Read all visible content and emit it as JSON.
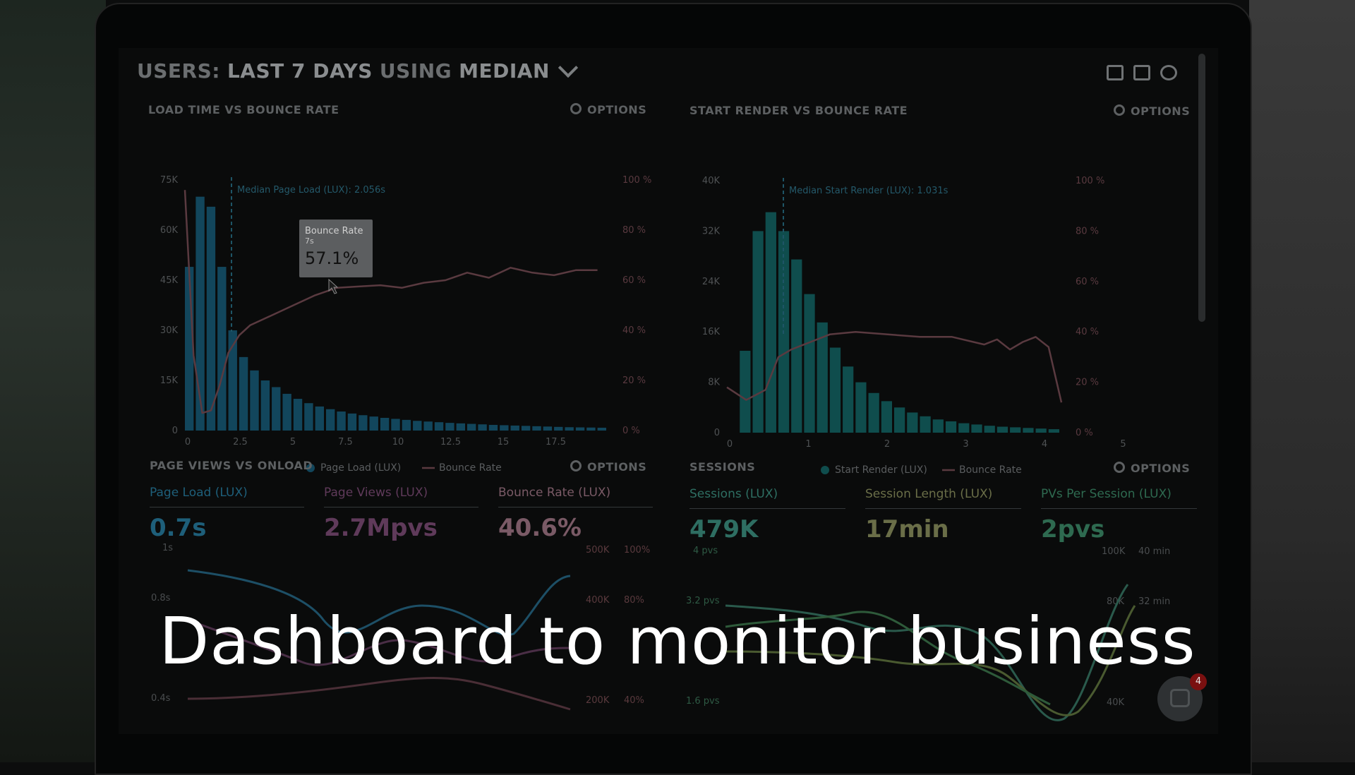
{
  "header": {
    "users_label": "USERS:",
    "period_label": "LAST 7 DAYS",
    "using_label": "USING",
    "stat_label": "MEDIAN"
  },
  "panels": {
    "load_time": {
      "title": "LOAD TIME VS BOUNCE RATE",
      "options": "OPTIONS",
      "median_note": "Median Page Load (LUX): 2.056s",
      "tooltip": {
        "title": "Bounce Rate",
        "sub": "7s",
        "value": "57.1%"
      },
      "legend": [
        "Page Load (LUX)",
        "Bounce Rate"
      ]
    },
    "start_render": {
      "title": "START RENDER VS BOUNCE RATE",
      "options": "OPTIONS",
      "median_note": "Median Start Render (LUX): 1.031s",
      "legend": [
        "Start Render (LUX)",
        "Bounce Rate"
      ]
    },
    "page_views": {
      "title": "PAGE VIEWS VS ONLOAD",
      "options": "OPTIONS",
      "metrics": [
        {
          "label": "Page Load (LUX)",
          "value": "0.7s",
          "color": "#1e5f7a"
        },
        {
          "label": "Page Views (LUX)",
          "value": "2.7Mpvs",
          "color": "#5f3a5a"
        },
        {
          "label": "Bounce Rate (LUX)",
          "value": "40.6%",
          "color": "#7a5a66"
        }
      ]
    },
    "sessions": {
      "title": "SESSIONS",
      "options": "OPTIONS",
      "metrics": [
        {
          "label": "Sessions (LUX)",
          "value": "479K",
          "color": "#2e6e62"
        },
        {
          "label": "Session Length (LUX)",
          "value": "17min",
          "color": "#6a6e48"
        },
        {
          "label": "PVs Per Session (LUX)",
          "value": "2pvs",
          "color": "#2e6a50"
        }
      ]
    }
  },
  "overlay_title": "Dashboard to monitor business",
  "chat_badge": "4",
  "chart_data": [
    {
      "type": "bar",
      "title": "LOAD TIME VS BOUNCE RATE",
      "x_ticks": [
        "0",
        "2.5",
        "5",
        "7.5",
        "10",
        "12.5",
        "15",
        "17.5"
      ],
      "y_left_ticks": [
        "0",
        "15K",
        "30K",
        "45K",
        "60K",
        "75K"
      ],
      "y_right_ticks": [
        "0 %",
        "20 %",
        "40 %",
        "60 %",
        "80 %",
        "100 %"
      ],
      "xlim": [
        0,
        19.5
      ],
      "ylim": [
        0,
        75000
      ],
      "bar_width": 0.5,
      "series": [
        {
          "name": "Page Load (LUX)",
          "x": [
            0,
            0.5,
            1,
            1.5,
            2,
            2.5,
            3,
            3.5,
            4,
            4.5,
            5,
            5.5,
            6,
            6.5,
            7,
            7.5,
            8,
            8.5,
            9,
            9.5,
            10,
            10.5,
            11,
            11.5,
            12,
            12.5,
            13,
            13.5,
            14,
            14.5,
            15,
            15.5,
            16,
            16.5,
            17,
            17.5,
            18,
            18.5,
            19
          ],
          "values": [
            49000,
            70000,
            67000,
            49000,
            30000,
            22000,
            18000,
            15000,
            13000,
            11000,
            9500,
            8200,
            7200,
            6400,
            5700,
            5100,
            4600,
            4200,
            3800,
            3500,
            3200,
            2900,
            2700,
            2500,
            2300,
            2150,
            2000,
            1850,
            1700,
            1600,
            1500,
            1400,
            1300,
            1200,
            1100,
            1000,
            950,
            900,
            850
          ]
        },
        {
          "name": "Bounce Rate",
          "axis": "right",
          "x": [
            0,
            0.4,
            0.8,
            1.2,
            1.6,
            2,
            2.5,
            3,
            4,
            5,
            6,
            7,
            8,
            9,
            10,
            11,
            12,
            13,
            14,
            15,
            16,
            17,
            18,
            19
          ],
          "values": [
            96,
            30,
            7,
            8,
            18,
            31,
            38,
            42,
            46,
            50,
            54,
            57,
            57.5,
            58,
            57,
            59,
            60,
            63,
            61,
            65,
            63,
            62,
            64,
            64
          ]
        }
      ]
    },
    {
      "type": "bar",
      "title": "START RENDER VS BOUNCE RATE",
      "x_ticks": [
        "0",
        "1",
        "2",
        "3",
        "4",
        "5"
      ],
      "y_left_ticks": [
        "0",
        "8K",
        "16K",
        "24K",
        "32K",
        "40K"
      ],
      "y_right_ticks": [
        "0 %",
        "20 %",
        "40 %",
        "60 %",
        "80 %",
        "100 %"
      ],
      "xlim": [
        0,
        5.2
      ],
      "ylim": [
        0,
        40000
      ],
      "bar_width": 0.2,
      "series": [
        {
          "name": "Start Render (LUX)",
          "x": [
            0.2,
            0.4,
            0.6,
            0.8,
            1.0,
            1.2,
            1.4,
            1.6,
            1.8,
            2.0,
            2.2,
            2.4,
            2.6,
            2.8,
            3.0,
            3.2,
            3.4,
            3.6,
            3.8,
            4.0,
            4.2,
            4.4,
            4.6,
            4.8,
            5.0
          ],
          "values": [
            13000,
            32000,
            35000,
            32000,
            27500,
            22000,
            17500,
            13500,
            10500,
            8000,
            6300,
            5000,
            4000,
            3200,
            2600,
            2100,
            1800,
            1500,
            1300,
            1100,
            950,
            850,
            750,
            650,
            550
          ]
        },
        {
          "name": "Bounce Rate",
          "axis": "right",
          "x": [
            0,
            0.3,
            0.6,
            0.8,
            1.0,
            1.3,
            1.6,
            2.0,
            2.5,
            3.0,
            3.5,
            4.0,
            4.2,
            4.4,
            4.6,
            4.8,
            5.0,
            5.2
          ],
          "values": [
            18,
            13,
            17,
            30,
            33,
            36,
            39,
            40,
            39,
            38,
            38,
            35,
            37,
            33,
            36,
            38,
            34,
            12
          ]
        }
      ]
    }
  ]
}
